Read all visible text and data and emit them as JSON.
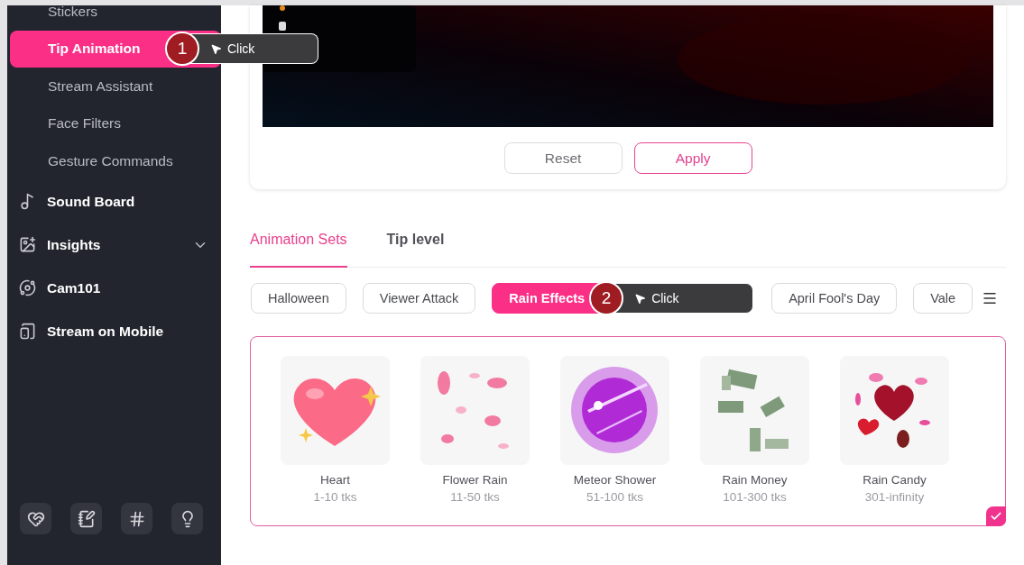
{
  "sidebar": {
    "items": [
      {
        "label": "Stickers",
        "kind": "sub",
        "selected": false
      },
      {
        "label": "Tip Animation",
        "kind": "sub",
        "selected": true,
        "callout": {
          "number": "1",
          "label": "Click"
        }
      },
      {
        "label": "Stream Assistant",
        "kind": "sub",
        "selected": false
      },
      {
        "label": "Face Filters",
        "kind": "sub",
        "selected": false
      },
      {
        "label": "Gesture Commands",
        "kind": "sub",
        "selected": false
      },
      {
        "label": "Sound Board",
        "kind": "main",
        "selected": false
      },
      {
        "label": "Insights",
        "kind": "group",
        "selected": false
      },
      {
        "label": "Cam101",
        "kind": "main",
        "selected": false
      },
      {
        "label": "Stream on Mobile",
        "kind": "main",
        "selected": false
      }
    ]
  },
  "preview_buttons": [
    {
      "label": "Reset",
      "kind": "secondary"
    },
    {
      "label": "Apply",
      "kind": "primary"
    }
  ],
  "tabs": [
    {
      "label": "Animation Sets",
      "selected": true
    },
    {
      "label": "Tip level",
      "selected": false
    }
  ],
  "chips": [
    {
      "label": "Halloween",
      "selected": false
    },
    {
      "label": "Viewer Attack",
      "selected": false
    },
    {
      "label": "Rain Effects",
      "selected": true,
      "callout": {
        "number": "2",
        "label": "Click"
      }
    },
    {
      "label": "April Fool's Day",
      "selected": false
    },
    {
      "label": "Vale",
      "selected": false
    }
  ],
  "effects": {
    "selected": true,
    "items": [
      {
        "name": "Heart",
        "range": "1-10 tks"
      },
      {
        "name": "Flower Rain",
        "range": "11-50 tks"
      },
      {
        "name": "Meteor Shower",
        "range": "51-100 tks"
      },
      {
        "name": "Rain Money",
        "range": "101-300 tks"
      },
      {
        "name": "Rain Candy",
        "range": "301-infinity"
      }
    ]
  }
}
